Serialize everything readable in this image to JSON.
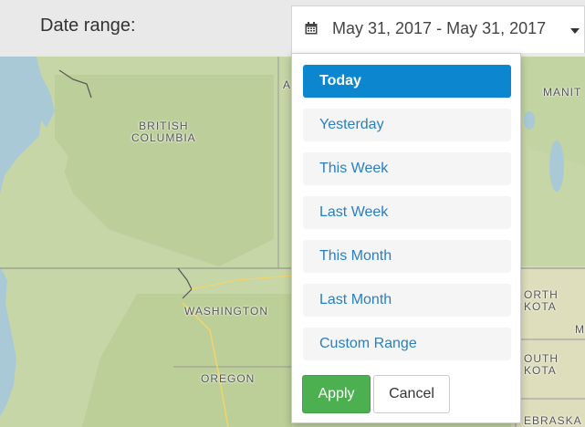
{
  "header": {
    "label": "Date range:",
    "range_value": "May 31, 2017 - May 31, 2017",
    "calendar_icon": "calendar-icon",
    "caret_icon": "caret-down-icon"
  },
  "dropdown": {
    "ranges": [
      {
        "label": "Today",
        "active": true
      },
      {
        "label": "Yesterday",
        "active": false
      },
      {
        "label": "This Week",
        "active": false
      },
      {
        "label": "Last Week",
        "active": false
      },
      {
        "label": "This Month",
        "active": false
      },
      {
        "label": "Last Month",
        "active": false
      },
      {
        "label": "Custom Range",
        "active": false
      }
    ],
    "apply_label": "Apply",
    "cancel_label": "Cancel",
    "accent_color": "#0b86cf",
    "apply_color": "#4cb050"
  },
  "map": {
    "labels": {
      "british_columbia": "BRITISH\nCOLUMBIA",
      "washington": "WASHINGTON",
      "oregon": "OREGON",
      "manitoba": "MANIT",
      "north_dakota": "ORTH\nKOTA",
      "south_dakota": "OUTH\nKOTA",
      "nebraska": "EBRASKA",
      "alberta_fragment": "A",
      "minnesota_fragment": "M"
    }
  }
}
